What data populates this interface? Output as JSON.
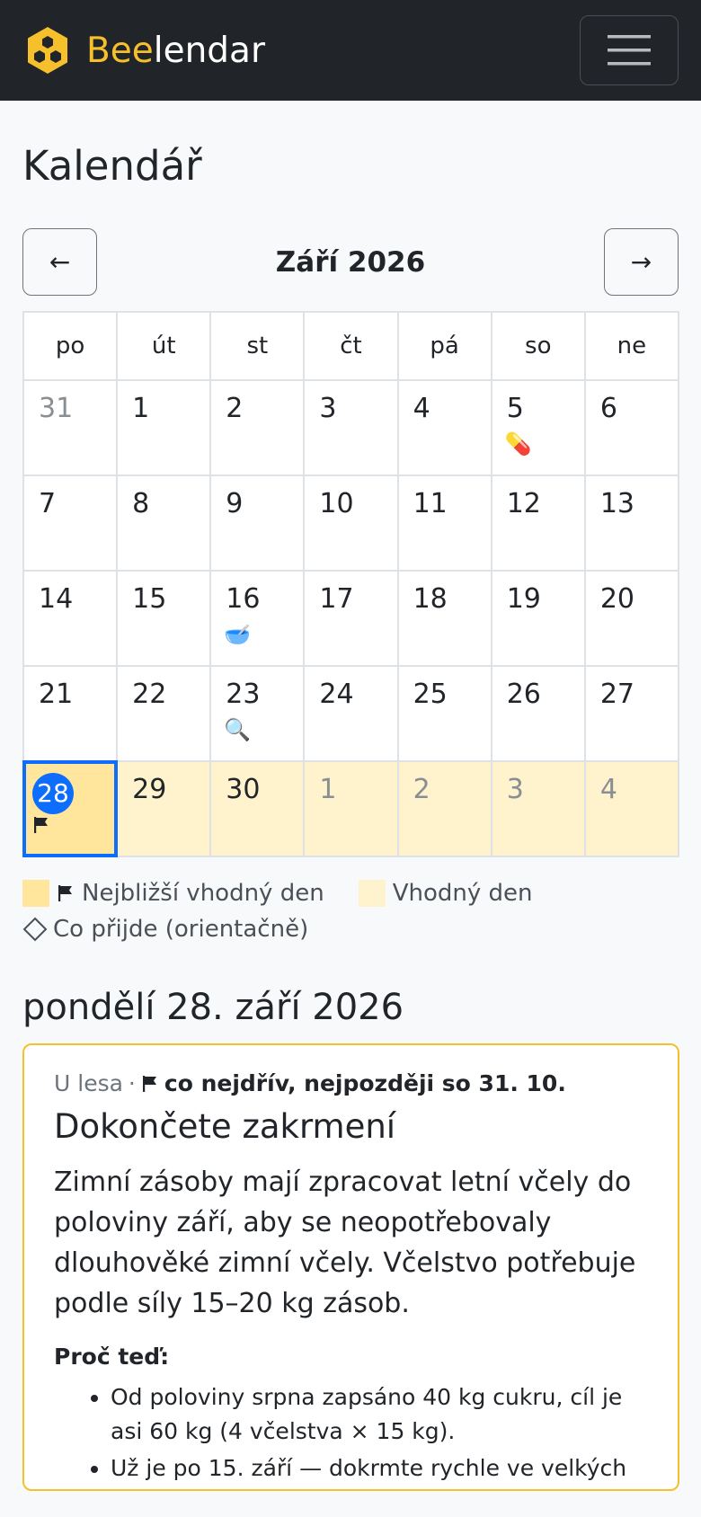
{
  "navbar": {
    "brand_bee": "Bee",
    "brand_rest": "lendar",
    "menu_icon": "hamburger-icon",
    "logo_icon": "honeycomb-icon"
  },
  "page": {
    "title": "Kalendář"
  },
  "month_nav": {
    "prev": "←",
    "title": "Září 2026",
    "next": "→"
  },
  "weekdays": [
    "po",
    "út",
    "st",
    "čt",
    "pá",
    "so",
    "ne"
  ],
  "weeks": [
    [
      {
        "day": "31",
        "muted": true
      },
      {
        "day": "1"
      },
      {
        "day": "2"
      },
      {
        "day": "3"
      },
      {
        "day": "4"
      },
      {
        "day": "5",
        "icon": "💊",
        "icon_name": "pill-icon"
      },
      {
        "day": "6"
      }
    ],
    [
      {
        "day": "7"
      },
      {
        "day": "8"
      },
      {
        "day": "9"
      },
      {
        "day": "10"
      },
      {
        "day": "11"
      },
      {
        "day": "12"
      },
      {
        "day": "13"
      }
    ],
    [
      {
        "day": "14"
      },
      {
        "day": "15"
      },
      {
        "day": "16",
        "icon": "🥣",
        "icon_name": "bowl-icon"
      },
      {
        "day": "17"
      },
      {
        "day": "18"
      },
      {
        "day": "19"
      },
      {
        "day": "20"
      }
    ],
    [
      {
        "day": "21"
      },
      {
        "day": "22"
      },
      {
        "day": "23",
        "icon": "🔍",
        "icon_name": "magnifier-icon"
      },
      {
        "day": "24"
      },
      {
        "day": "25"
      },
      {
        "day": "26"
      },
      {
        "day": "27"
      }
    ],
    [
      {
        "day": "28",
        "today": true,
        "suitable": true,
        "flag": true
      },
      {
        "day": "29",
        "suitable": true
      },
      {
        "day": "30",
        "suitable": true
      },
      {
        "day": "1",
        "muted": true,
        "suitable": true
      },
      {
        "day": "2",
        "muted": true,
        "suitable": true
      },
      {
        "day": "3",
        "muted": true,
        "suitable": true
      },
      {
        "day": "4",
        "muted": true,
        "suitable": true
      }
    ]
  ],
  "legend": {
    "nearest": "Nejbližší vhodný den",
    "suitable": "Vhodný den",
    "upcoming": "Co přijde (orientačně)"
  },
  "selected_date": "pondělí 28. září 2026",
  "card": {
    "location": "U lesa",
    "separator": "·",
    "deadline": "co nejdřív, nejpozději so 31. 10.",
    "title": "Dokončete zakrmení",
    "text": "Zimní zásoby mají zpracovat letní včely do poloviny září, aby se neopotřebovaly dlouhověké zimní včely. Včelstvo potřebuje podle síly 15–20 kg zásob.",
    "why_label": "Proč teď:",
    "reasons": [
      "Od poloviny srpna zapsáno 40 kg cukru, cíl je asi 60 kg (4 včelstva × 15 kg).",
      "Už je po 15. září — dokrmte rychle ve velkých"
    ]
  },
  "colors": {
    "navbar_bg": "#212529",
    "brand_yellow": "#f6c02c",
    "suitable_bg": "#fff3cd",
    "nearest_bg": "#ffe69c",
    "today_blue": "#0d6efd"
  }
}
